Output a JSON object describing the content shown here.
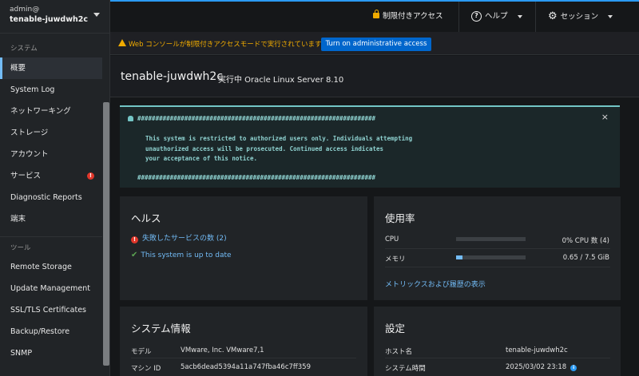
{
  "sidebar": {
    "host_user": "admin@",
    "host_name": "tenable-juwdwh2c",
    "section_system": "システム",
    "section_tools": "ツール",
    "items": [
      {
        "label": "概要"
      },
      {
        "label": "System Log"
      },
      {
        "label": "ネットワーキング"
      },
      {
        "label": "ストレージ"
      },
      {
        "label": "アカウント"
      },
      {
        "label": "サービス",
        "badge": "!"
      },
      {
        "label": "Diagnostic Reports"
      },
      {
        "label": "端末"
      }
    ],
    "tools": [
      {
        "label": "Remote Storage"
      },
      {
        "label": "Update Management"
      },
      {
        "label": "SSL/TLS Certificates"
      },
      {
        "label": "Backup/Restore"
      },
      {
        "label": "SNMP"
      }
    ]
  },
  "topbar": {
    "restricted_label": "制限付きアクセス",
    "help_label": "ヘルプ",
    "session_label": "セッション",
    "help_icon_glyph": "?",
    "gear_icon_glyph": "⚙"
  },
  "alert": {
    "text": "Web コンソールが制限付きアクセスモードで実行されています。",
    "button_label": "Turn on administrative access"
  },
  "header": {
    "title": "tenable-juwdwh2c",
    "subtitle": "実行中 Oracle Linux Server 8.10"
  },
  "motd": {
    "close_glyph": "×",
    "lines": [
      "##################################################################",
      "This system is restricted to authorized users only. Individuals attempting",
      "unauthorized access will be prosecuted. Continued access indicates",
      "your acceptance of this notice.",
      "##################################################################"
    ]
  },
  "health": {
    "title": "ヘルス",
    "failed_services": "失敗したサービスの数 (2)",
    "error_glyph": "!",
    "up_to_date": "This system is up to date",
    "check_glyph": "✔"
  },
  "usage": {
    "title": "使用率",
    "cpu_label": "CPU",
    "cpu_value": "0% CPU 数 (4)",
    "cpu_fraction": 0.0,
    "memory_label": "メモリ",
    "memory_value": "0.65 / 7.5 GiB",
    "memory_fraction": 0.087,
    "metrics_link": "メトリックスおよび履歴の表示"
  },
  "sysinfo": {
    "title": "システム情報",
    "model_label": "モデル",
    "model_value": "VMware, Inc. VMware7,1",
    "machine_id_label": "マシン ID",
    "machine_id_value": "5acb6dead5394a11a747fba46c7ff359"
  },
  "config": {
    "title": "設定",
    "hostname_label": "ホスト名",
    "hostname_value": "tenable-juwdwh2c",
    "time_label": "システム時間",
    "time_value": "2025/03/02 23:18",
    "info_glyph": "i"
  },
  "colors": {
    "accent": "#2b9af3",
    "link": "#73bcf7",
    "warning": "#f0ab00",
    "danger": "#e0362a",
    "success": "#5ba352",
    "motd_text": "#8fd3d1"
  }
}
